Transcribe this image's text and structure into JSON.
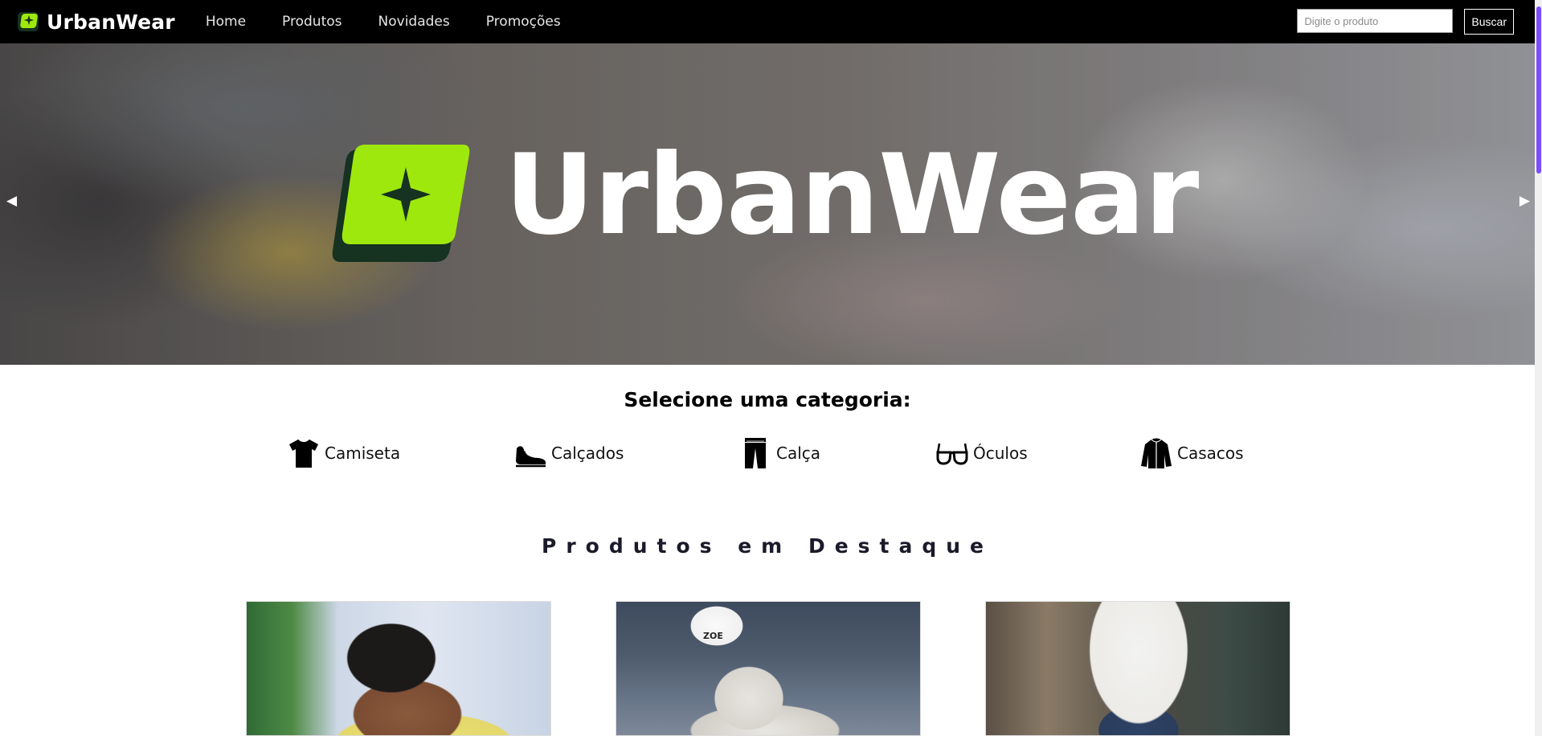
{
  "navbar": {
    "brand": "UrbanWear",
    "links": [
      "Home",
      "Produtos",
      "Novidades",
      "Promoções"
    ],
    "search": {
      "placeholder": "Digite o produto",
      "value": ""
    },
    "search_button": "Buscar"
  },
  "hero": {
    "logo_text": "UrbanWear",
    "prev_glyph": "◀",
    "next_glyph": "▶"
  },
  "categories": {
    "title": "Selecione uma categoria:",
    "items": [
      {
        "label": "Camiseta",
        "icon": "tshirt-icon"
      },
      {
        "label": "Calçados",
        "icon": "sneaker-icon"
      },
      {
        "label": "Calça",
        "icon": "pants-icon"
      },
      {
        "label": "Óculos",
        "icon": "glasses-icon"
      },
      {
        "label": "Casacos",
        "icon": "jacket-icon"
      }
    ]
  },
  "featured": {
    "title": "Produtos em Destaque",
    "products": [
      {
        "image": "man-yellow-shirt-photo"
      },
      {
        "image": "white-sneaker-photo",
        "sock_text": "ZOE"
      },
      {
        "image": "white-tshirt-jeans-photo"
      }
    ]
  },
  "colors": {
    "brand_green": "#9fe80d",
    "brand_dark_green": "#163220",
    "navbar_bg": "#000000",
    "scroll_thumb": "#7c4dff"
  }
}
